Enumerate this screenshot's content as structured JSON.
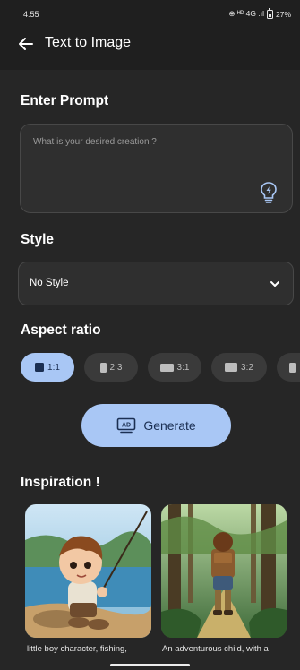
{
  "status_bar": {
    "time": "4:55",
    "signal_text": "⊕ ᴴᴰ 4G .ıl",
    "battery": "27%"
  },
  "top_bar": {
    "title": "Text to Image"
  },
  "prompt": {
    "section_title": "Enter Prompt",
    "placeholder": "What is your desired creation ?",
    "value": ""
  },
  "style": {
    "section_title": "Style",
    "selected": "No Style"
  },
  "aspect_ratio": {
    "section_title": "Aspect ratio",
    "options": [
      {
        "label": "1:1",
        "selected": true
      },
      {
        "label": "2:3",
        "selected": false
      },
      {
        "label": "3:1",
        "selected": false
      },
      {
        "label": "3:2",
        "selected": false
      },
      {
        "label": "",
        "selected": false
      }
    ]
  },
  "generate": {
    "label": "Generate",
    "icon_text": "AD"
  },
  "inspiration": {
    "section_title": "Inspiration !",
    "cards": [
      {
        "caption": "little boy character, fishing,"
      },
      {
        "caption": "An adventurous child, with a"
      }
    ]
  },
  "colors": {
    "background": "#262626",
    "top_bar": "#1f1f1f",
    "accent": "#a9c7f5",
    "accent_text": "#1b2f52",
    "field": "#2f2f2f",
    "chip": "#3a3a3a"
  }
}
